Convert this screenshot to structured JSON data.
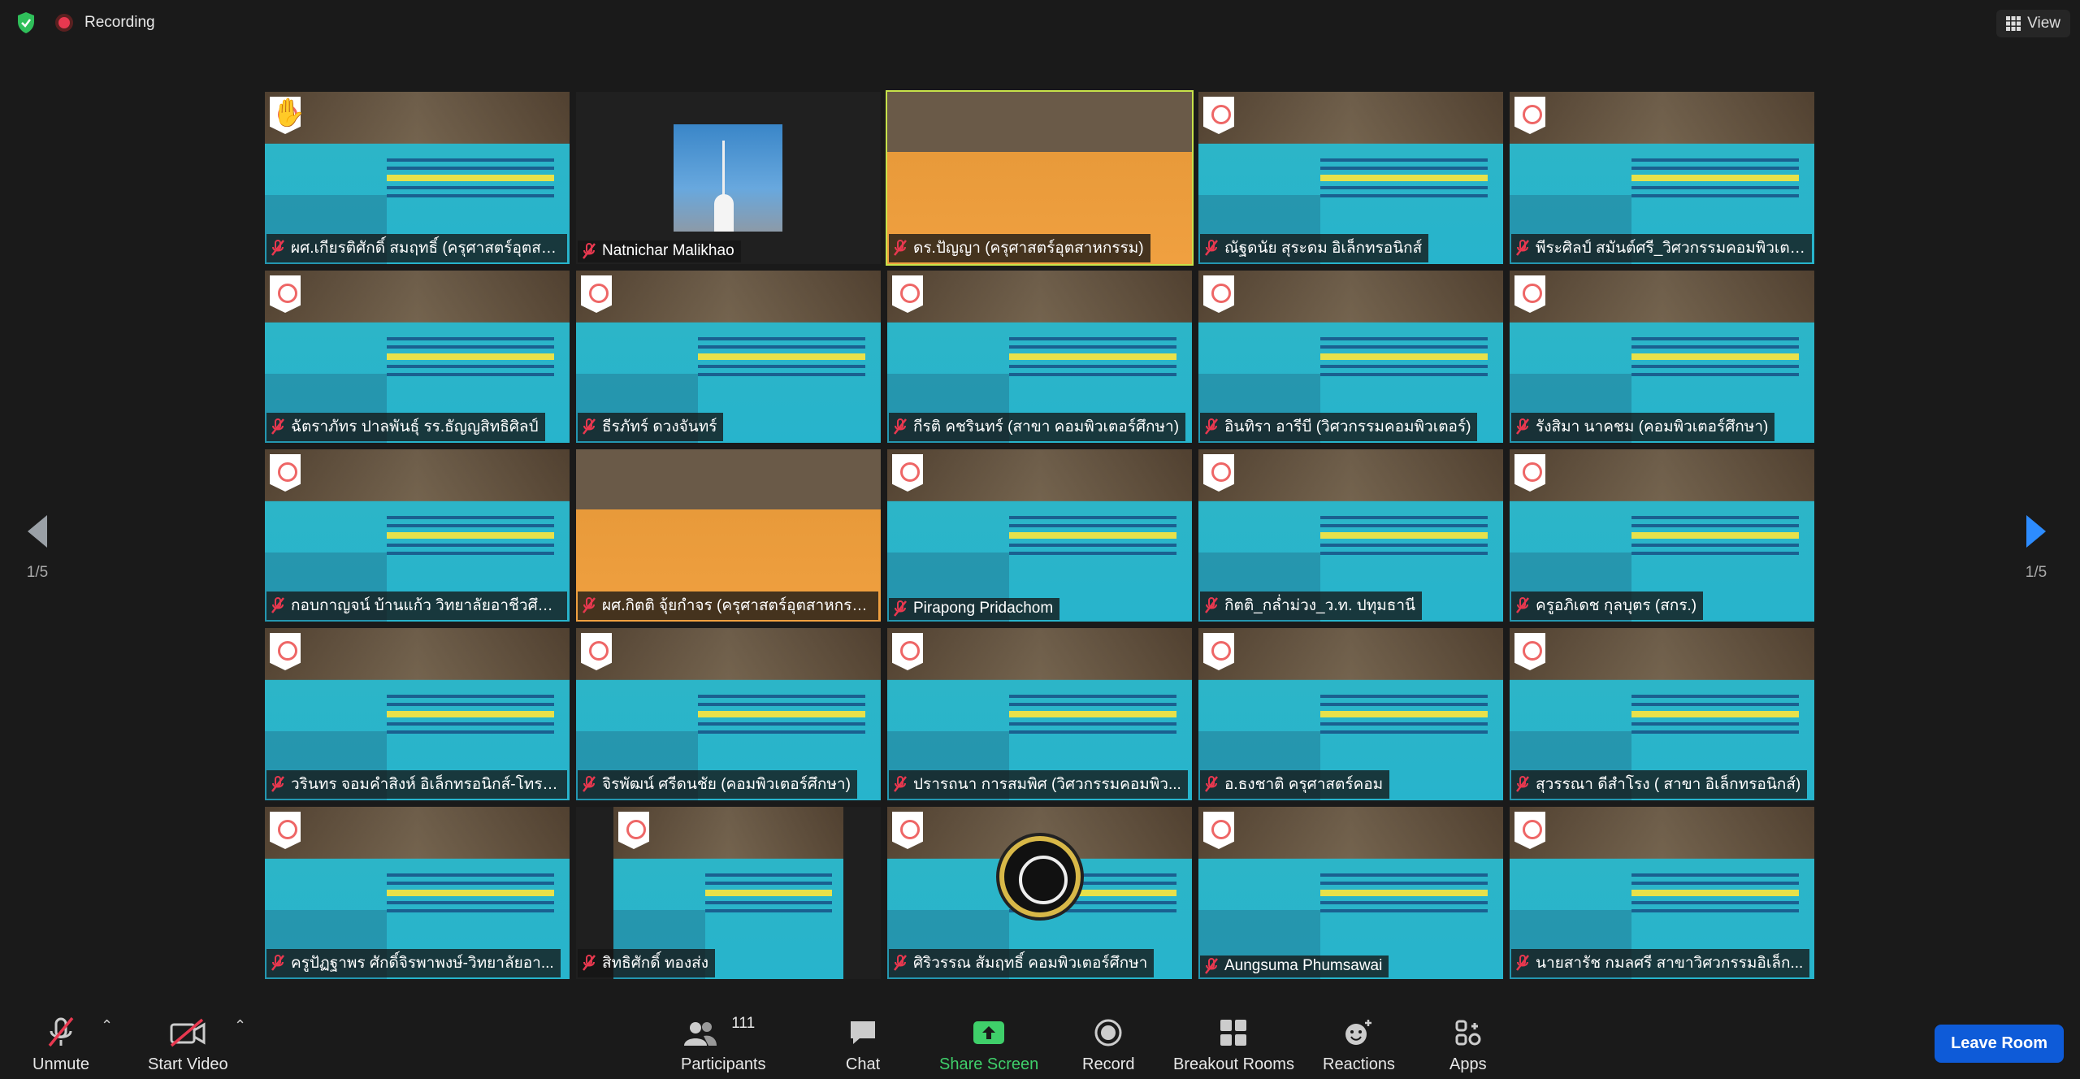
{
  "top": {
    "recording_label": "Recording",
    "view_label": "View"
  },
  "pager": {
    "left_page": "1/5",
    "right_page": "1/5"
  },
  "tiles": [
    {
      "name": "ผศ.เกียรติศักดิ์ สมฤทธิ์ (ครุศาสตร์อุตสา...",
      "bg": "virtual",
      "hand": true
    },
    {
      "name": "Natnichar Malikhao",
      "bg": "dark"
    },
    {
      "name": "ดร.ปัญญา (ครุศาสตร์อุตสาหกรรม)",
      "bg": "orange",
      "active": true
    },
    {
      "name": "ณัฐดนัย สุระดม อิเล็กทรอนิกส์",
      "bg": "virtual"
    },
    {
      "name": "พีระศิลป์ สมันต์ศรี_วิศวกรรมคอมพิวเตอร์",
      "bg": "virtual"
    },
    {
      "name": "ฉัตราภัทร ปาลพันธุ์ รร.ธัญญสิทธิศิลป์",
      "bg": "virtual"
    },
    {
      "name": "ธีรภัทร์ ดวงจันทร์",
      "bg": "virtual"
    },
    {
      "name": "กีรติ คชรินทร์ (สาขา คอมพิวเตอร์ศึกษา)",
      "bg": "virtual"
    },
    {
      "name": "อินทิรา อารีบี (วิศวกรรมคอมพิวเตอร์)",
      "bg": "virtual"
    },
    {
      "name": "รังสิมา นาคชม (คอมพิวเตอร์ศึกษา)",
      "bg": "virtual"
    },
    {
      "name": "กอบกาญจน์ บ้านแก้ว วิทยาลัยอาชีวศึกษ...",
      "bg": "virtual"
    },
    {
      "name": "ผศ.กิตติ จุ้ยกำจร (ครุศาสตร์อุตสาหกรรม)",
      "bg": "orange"
    },
    {
      "name": "Pirapong Pridachom",
      "bg": "virtual"
    },
    {
      "name": "กิตติ_กล่ำม่วง_ว.ท. ปทุมธานี",
      "bg": "virtual"
    },
    {
      "name": "ครูอภิเดช กุลบุตร (สกร.)",
      "bg": "virtual"
    },
    {
      "name": "วรินทร จอมคำสิงห์ อิเล็กทรอนิกส์-โทรค...",
      "bg": "virtual"
    },
    {
      "name": "จิรพัฒน์ ศรีดนชัย (คอมพิวเตอร์ศึกษา)",
      "bg": "virtual"
    },
    {
      "name": "ปรารถนา การสมพิศ (วิศวกรรมคอมพิว...",
      "bg": "virtual"
    },
    {
      "name": "อ.ธงชาติ ครุศาสตร์คอม",
      "bg": "virtual"
    },
    {
      "name": "สุวรรณา ดีสำโรง ( สาขา อิเล็กทรอนิกส์)",
      "bg": "virtual"
    },
    {
      "name": "ครูปัฏฐาพร ศักดิ์จิรพาพงษ์-วิทยาลัยอา...",
      "bg": "virtual"
    },
    {
      "name": "สิทธิศักดิ์ ทองส่ง",
      "bg": "virtual_narrow"
    },
    {
      "name": "ศิริวรรณ สัมฤทธิ์ คอมพิวเตอร์ศึกษา",
      "bg": "virtual",
      "emblem": true
    },
    {
      "name": "Aungsuma Phumsawai",
      "bg": "virtual"
    },
    {
      "name": "นายสารัช กมลศรี สาขาวิศวกรรมอิเล็ก...",
      "bg": "virtual"
    }
  ],
  "toolbar": {
    "unmute": "Unmute",
    "start_video": "Start Video",
    "participants": "Participants",
    "participants_count": "111",
    "chat": "Chat",
    "share_screen": "Share Screen",
    "record": "Record",
    "breakout_rooms": "Breakout Rooms",
    "reactions": "Reactions",
    "apps": "Apps",
    "leave": "Leave Room"
  },
  "colors": {
    "accent_green": "#3fcf6a",
    "leave_blue": "#0e5bd8",
    "muted_red": "#e8384f",
    "active_outline": "#c7e24a"
  }
}
